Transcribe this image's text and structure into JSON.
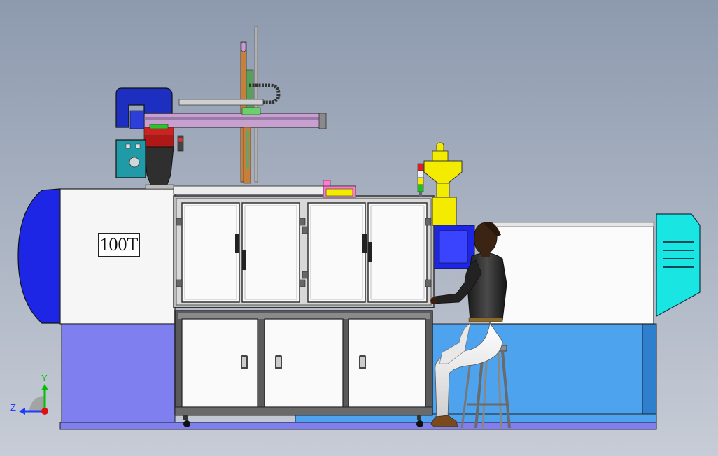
{
  "scene": {
    "machine_label": "100T",
    "colors": {
      "background_top": "#8d9aae",
      "background_bottom": "#c7ccd6",
      "base_blue": "#7f7ff0",
      "base_light_blue": "#4ea3ef",
      "front_cover_blue": "#1e26e6",
      "panel_white": "#fafafa",
      "frame_gray": "#4a4a4a",
      "hopper_yellow": "#f4ec00",
      "robot_blue": "#1c2fc0",
      "teal_box": "#1f9aa6",
      "guard_cyan": "#19e6e2",
      "robot_beam_purple": "#c8a0d0"
    },
    "components": [
      "injection-molding-machine",
      "mold-clamp-unit",
      "safety-door-cabinet",
      "lower-storage-cabinet",
      "material-hopper",
      "signal-tower-light",
      "gantry-robot",
      "cable-drag-chain",
      "control-box",
      "operator-figure",
      "bar-stool"
    ]
  },
  "triad": {
    "y_label": "Y",
    "z_label": "Z",
    "y_color": "#00c000",
    "z_color": "#1a3cff",
    "origin_color": "#e01010"
  }
}
